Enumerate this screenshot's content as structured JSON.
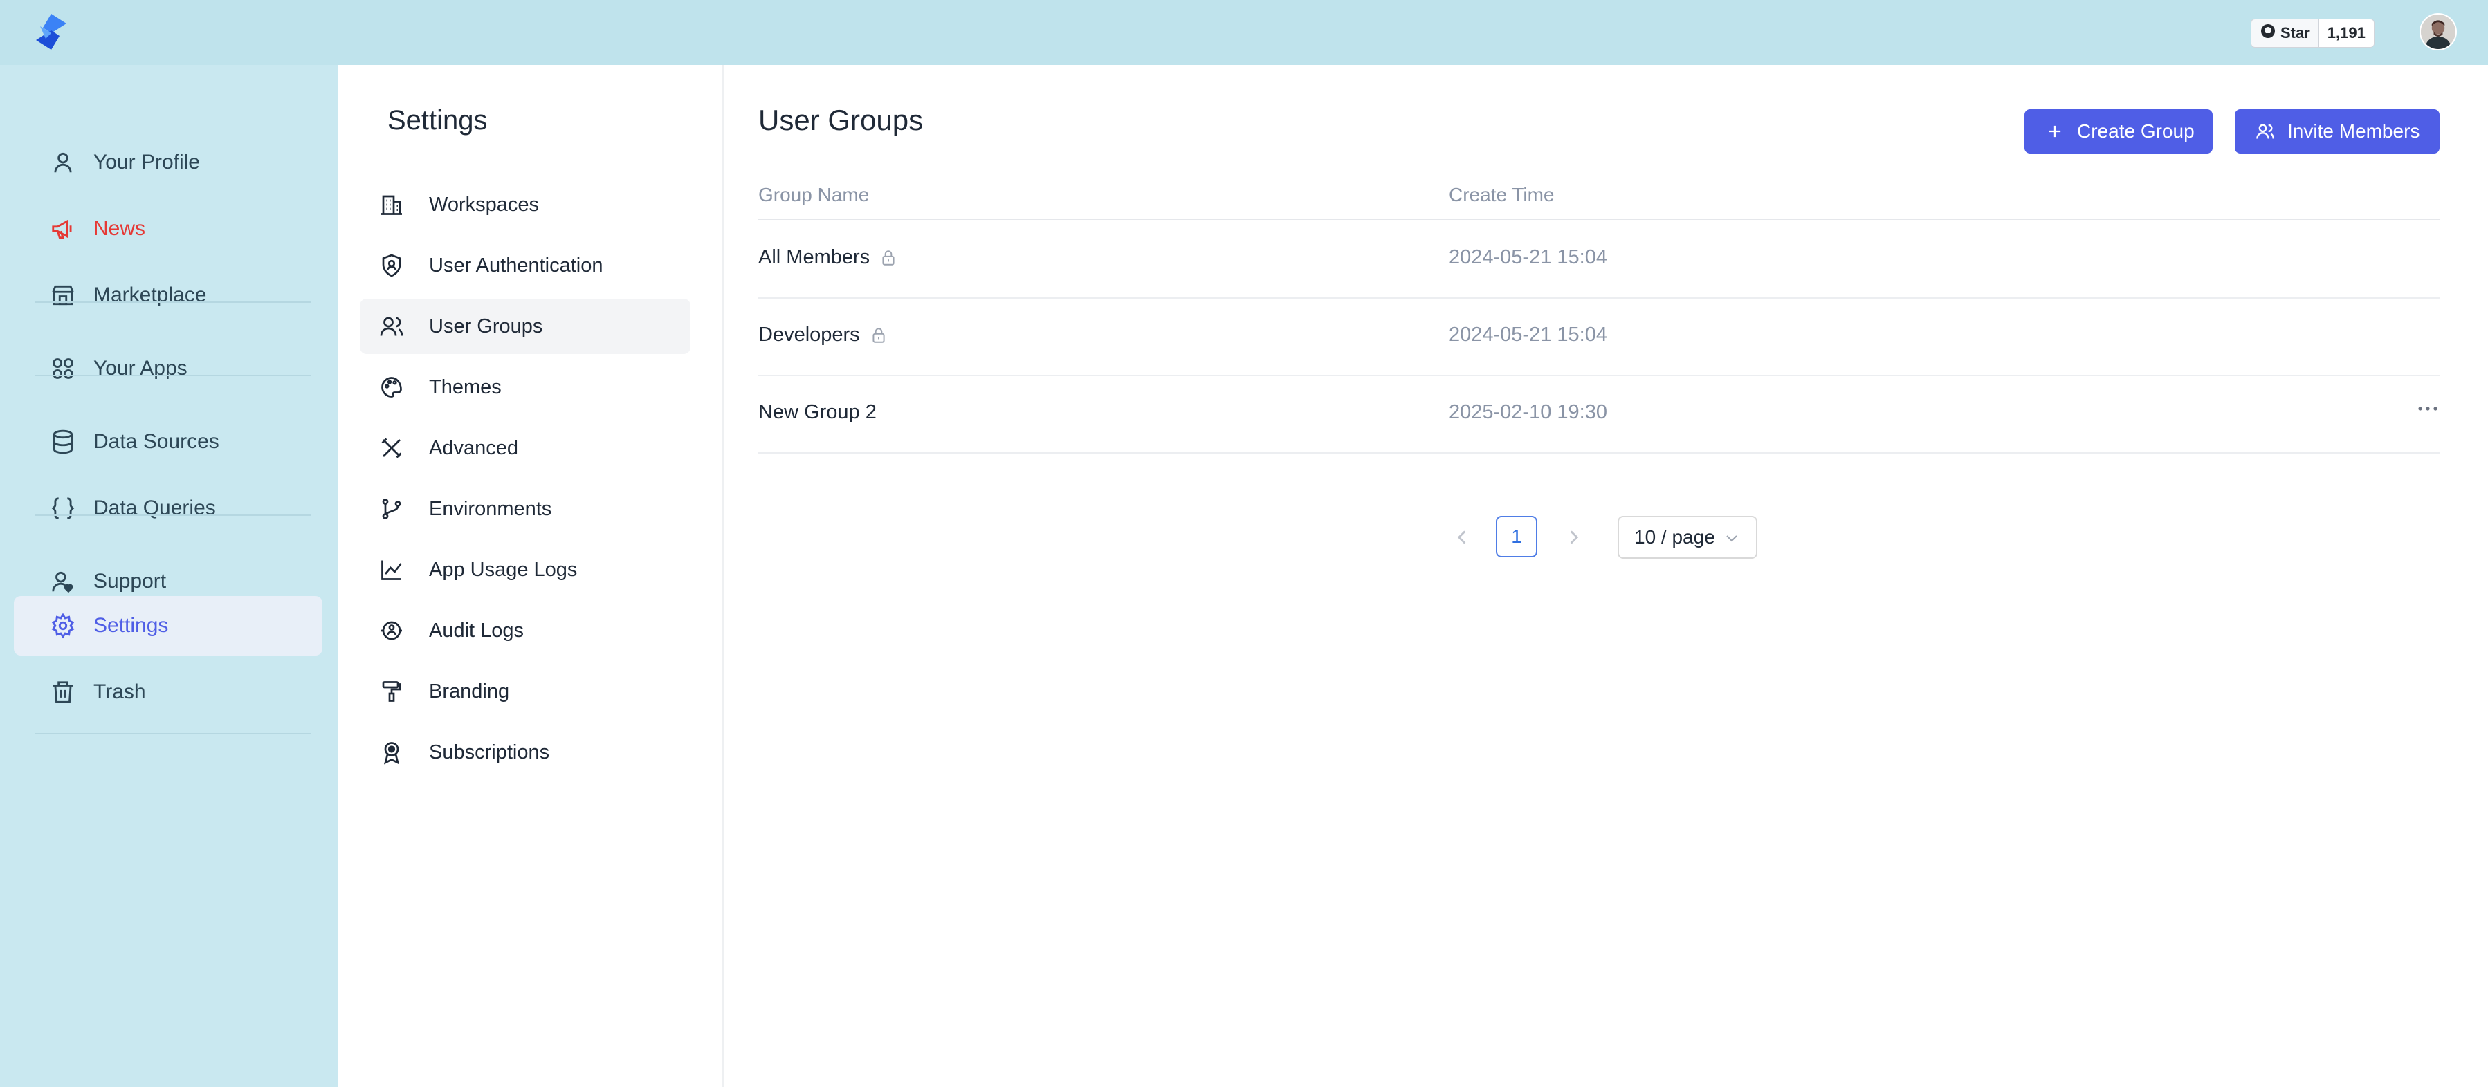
{
  "topbar": {
    "github_star_label": "Star",
    "github_star_count": "1,191"
  },
  "sidebar": {
    "items": [
      {
        "label": "Your Profile",
        "icon": "user-icon"
      },
      {
        "label": "News",
        "icon": "megaphone-icon"
      },
      {
        "label": "Marketplace",
        "icon": "store-icon"
      },
      {
        "label": "Your Apps",
        "icon": "apps-grid-icon"
      },
      {
        "label": "Data Sources",
        "icon": "database-icon"
      },
      {
        "label": "Data Queries",
        "icon": "braces-icon"
      },
      {
        "label": "Support",
        "icon": "support-user-icon"
      },
      {
        "label": "Settings",
        "icon": "gear-icon",
        "active": true
      },
      {
        "label": "Trash",
        "icon": "trash-icon"
      }
    ],
    "colors": {
      "active": "#4f5ee6",
      "news": "#e53935",
      "background": "#c9e8f0"
    }
  },
  "settings": {
    "title": "Settings",
    "items": [
      {
        "label": "Workspaces",
        "icon": "building-icon"
      },
      {
        "label": "User Authentication",
        "icon": "shield-user-icon"
      },
      {
        "label": "User Groups",
        "icon": "users-icon",
        "active": true
      },
      {
        "label": "Themes",
        "icon": "palette-icon"
      },
      {
        "label": "Advanced",
        "icon": "tools-icon"
      },
      {
        "label": "Environments",
        "icon": "git-branch-icon"
      },
      {
        "label": "App Usage Logs",
        "icon": "line-chart-icon"
      },
      {
        "label": "Audit Logs",
        "icon": "audit-eye-icon"
      },
      {
        "label": "Branding",
        "icon": "paint-roller-icon"
      },
      {
        "label": "Subscriptions",
        "icon": "badge-icon"
      }
    ]
  },
  "main": {
    "title": "User Groups",
    "create_button": "Create Group",
    "invite_button": "Invite Members",
    "columns": [
      "Group Name",
      "Create Time"
    ],
    "rows": [
      {
        "name": "All Members",
        "time": "2024-05-21 15:04",
        "locked": true
      },
      {
        "name": "Developers",
        "time": "2024-05-21 15:04",
        "locked": true
      },
      {
        "name": "New Group 2",
        "time": "2025-02-10 19:30",
        "locked": false
      }
    ],
    "pagination": {
      "current_page": "1",
      "page_size": "10 / page"
    },
    "accent": "#4f5ee6"
  }
}
